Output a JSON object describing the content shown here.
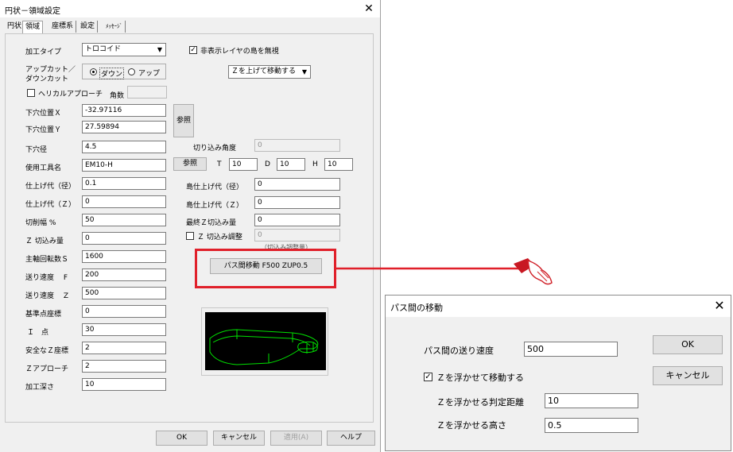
{
  "main": {
    "title": "円状－領域設定",
    "close": "✕",
    "tabs": [
      "円状",
      "領域",
      "座標系",
      "設定",
      "ﾒｯｾｰｼﾞ"
    ],
    "fields": {
      "process_type_label": "加工タイプ",
      "process_type_value": "トロコイド",
      "up_down_cut_label": "アップカット／\nダウンカット",
      "radio_down": "ダウン",
      "radio_up": "アップ",
      "helical_label": "ヘリカルアプローチ",
      "angle_count_label": "角数",
      "angle_count_value": "",
      "lower_hole_x_label": "下穴位置Ｘ",
      "lower_hole_x_value": "-32.97116",
      "lower_hole_y_label": "下穴位置Ｙ",
      "lower_hole_y_value": "27.59894",
      "ref_button": "参照",
      "lower_hole_dia_label": "下穴径",
      "lower_hole_dia_value": "4.5",
      "tool_name_label": "使用工具名",
      "tool_name_value": "EM10-H",
      "finish_dia_label": "仕上げ代（径）",
      "finish_dia_value": "0.1",
      "finish_z_label": "仕上げ代（Ｚ）",
      "finish_z_value": "0",
      "cut_width_label": "切削幅 %",
      "cut_width_value": "50",
      "z_cut_label": "Ｚ 切込み量",
      "z_cut_value": "0",
      "spindle_label": "主軸回転数Ｓ",
      "spindle_value": "1600",
      "feed_f_label": "送り速度　 F",
      "feed_f_value": "200",
      "feed_z_label": "送り速度　 Z",
      "feed_z_value": "500",
      "base_point_label": "基準点座標",
      "base_point_value": "0",
      "i_point_label": "Ｉ　点",
      "i_point_value": "30",
      "safe_z_label": "安全なＺ座標",
      "safe_z_value": "2",
      "z_approach_label": "Ｚアプローチ",
      "z_approach_value": "2",
      "depth_label": "加工深さ",
      "depth_value": "10",
      "ignore_hidden_label": "非表示レイヤの島を無視",
      "z_move_select": "Ｚを上げて移動する",
      "cut_angle_label": "切り込み角度",
      "cut_angle_value": "0",
      "ref_button2": "参照",
      "t_label": "T",
      "t_value": "10",
      "d_label": "D",
      "d_value": "10",
      "h_label": "H",
      "h_value": "10",
      "island_finish_dia_label": "島仕上げ代（径）",
      "island_finish_dia_value": "0",
      "island_finish_z_label": "島仕上げ代（Ｚ）",
      "island_finish_z_value": "0",
      "final_z_cut_label": "最終Ｚ切込み量",
      "final_z_cut_value": "0",
      "z_cut_adjust_label": "Ｚ 切込み調整",
      "z_cut_adjust_value": "0",
      "partial_label": "（切込み調整量）",
      "path_move_button": "パス間移動 F500 ZUP0.5"
    },
    "buttons": {
      "ok": "OK",
      "cancel": "キャンセル",
      "apply": "適用(A)",
      "help": "ヘルプ"
    }
  },
  "dialog": {
    "title": "パス間の移動",
    "close": "✕",
    "feed_label": "パス間の送り速度",
    "feed_value": "500",
    "float_label": "Ｚを浮かせて移動する",
    "judge_label": "Ｚを浮かせる判定距離",
    "judge_value": "10",
    "height_label": "Ｚを浮かせる高さ",
    "height_value": "0.5",
    "ok": "OK",
    "cancel": "キャンセル"
  },
  "colors": {
    "highlight": "#e0202a",
    "preview_bg": "#000000",
    "preview_line": "#00e000"
  }
}
